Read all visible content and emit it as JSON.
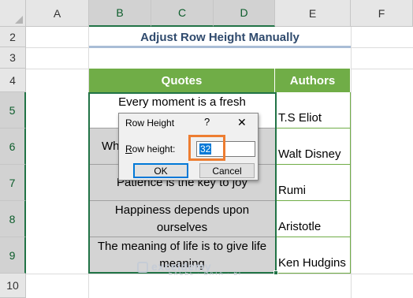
{
  "columns": [
    "A",
    "B",
    "C",
    "D",
    "E",
    "F"
  ],
  "rows": [
    "2",
    "3",
    "4",
    "5",
    "6",
    "7",
    "8",
    "9",
    "10"
  ],
  "sheet_title": "Adjust Row Height Manually",
  "table": {
    "headers": [
      "Quotes",
      "Authors"
    ],
    "quotes": [
      "Every moment is a fresh",
      "Wh",
      "Patience is the key to joy",
      "Happiness depends upon ourselves",
      "The meaning of life is to give life meaning"
    ],
    "authors": [
      "T.S Eliot",
      "Walt Disney",
      "Rumi",
      "Aristotle",
      "Ken Hudgins"
    ]
  },
  "dialog": {
    "title": "Row Height",
    "help": "?",
    "close": "✕",
    "label": "Row height:",
    "value": "32",
    "ok_label": "OK",
    "cancel_label": "Cancel"
  },
  "watermark": {
    "name": "exceldemy",
    "tagline": "EXCEL · DATA · BI"
  },
  "colors": {
    "header_green": "#70ad47",
    "selection_green": "#217346",
    "highlight_orange": "#ed7d31",
    "title_blue": "#2f4a6d"
  }
}
